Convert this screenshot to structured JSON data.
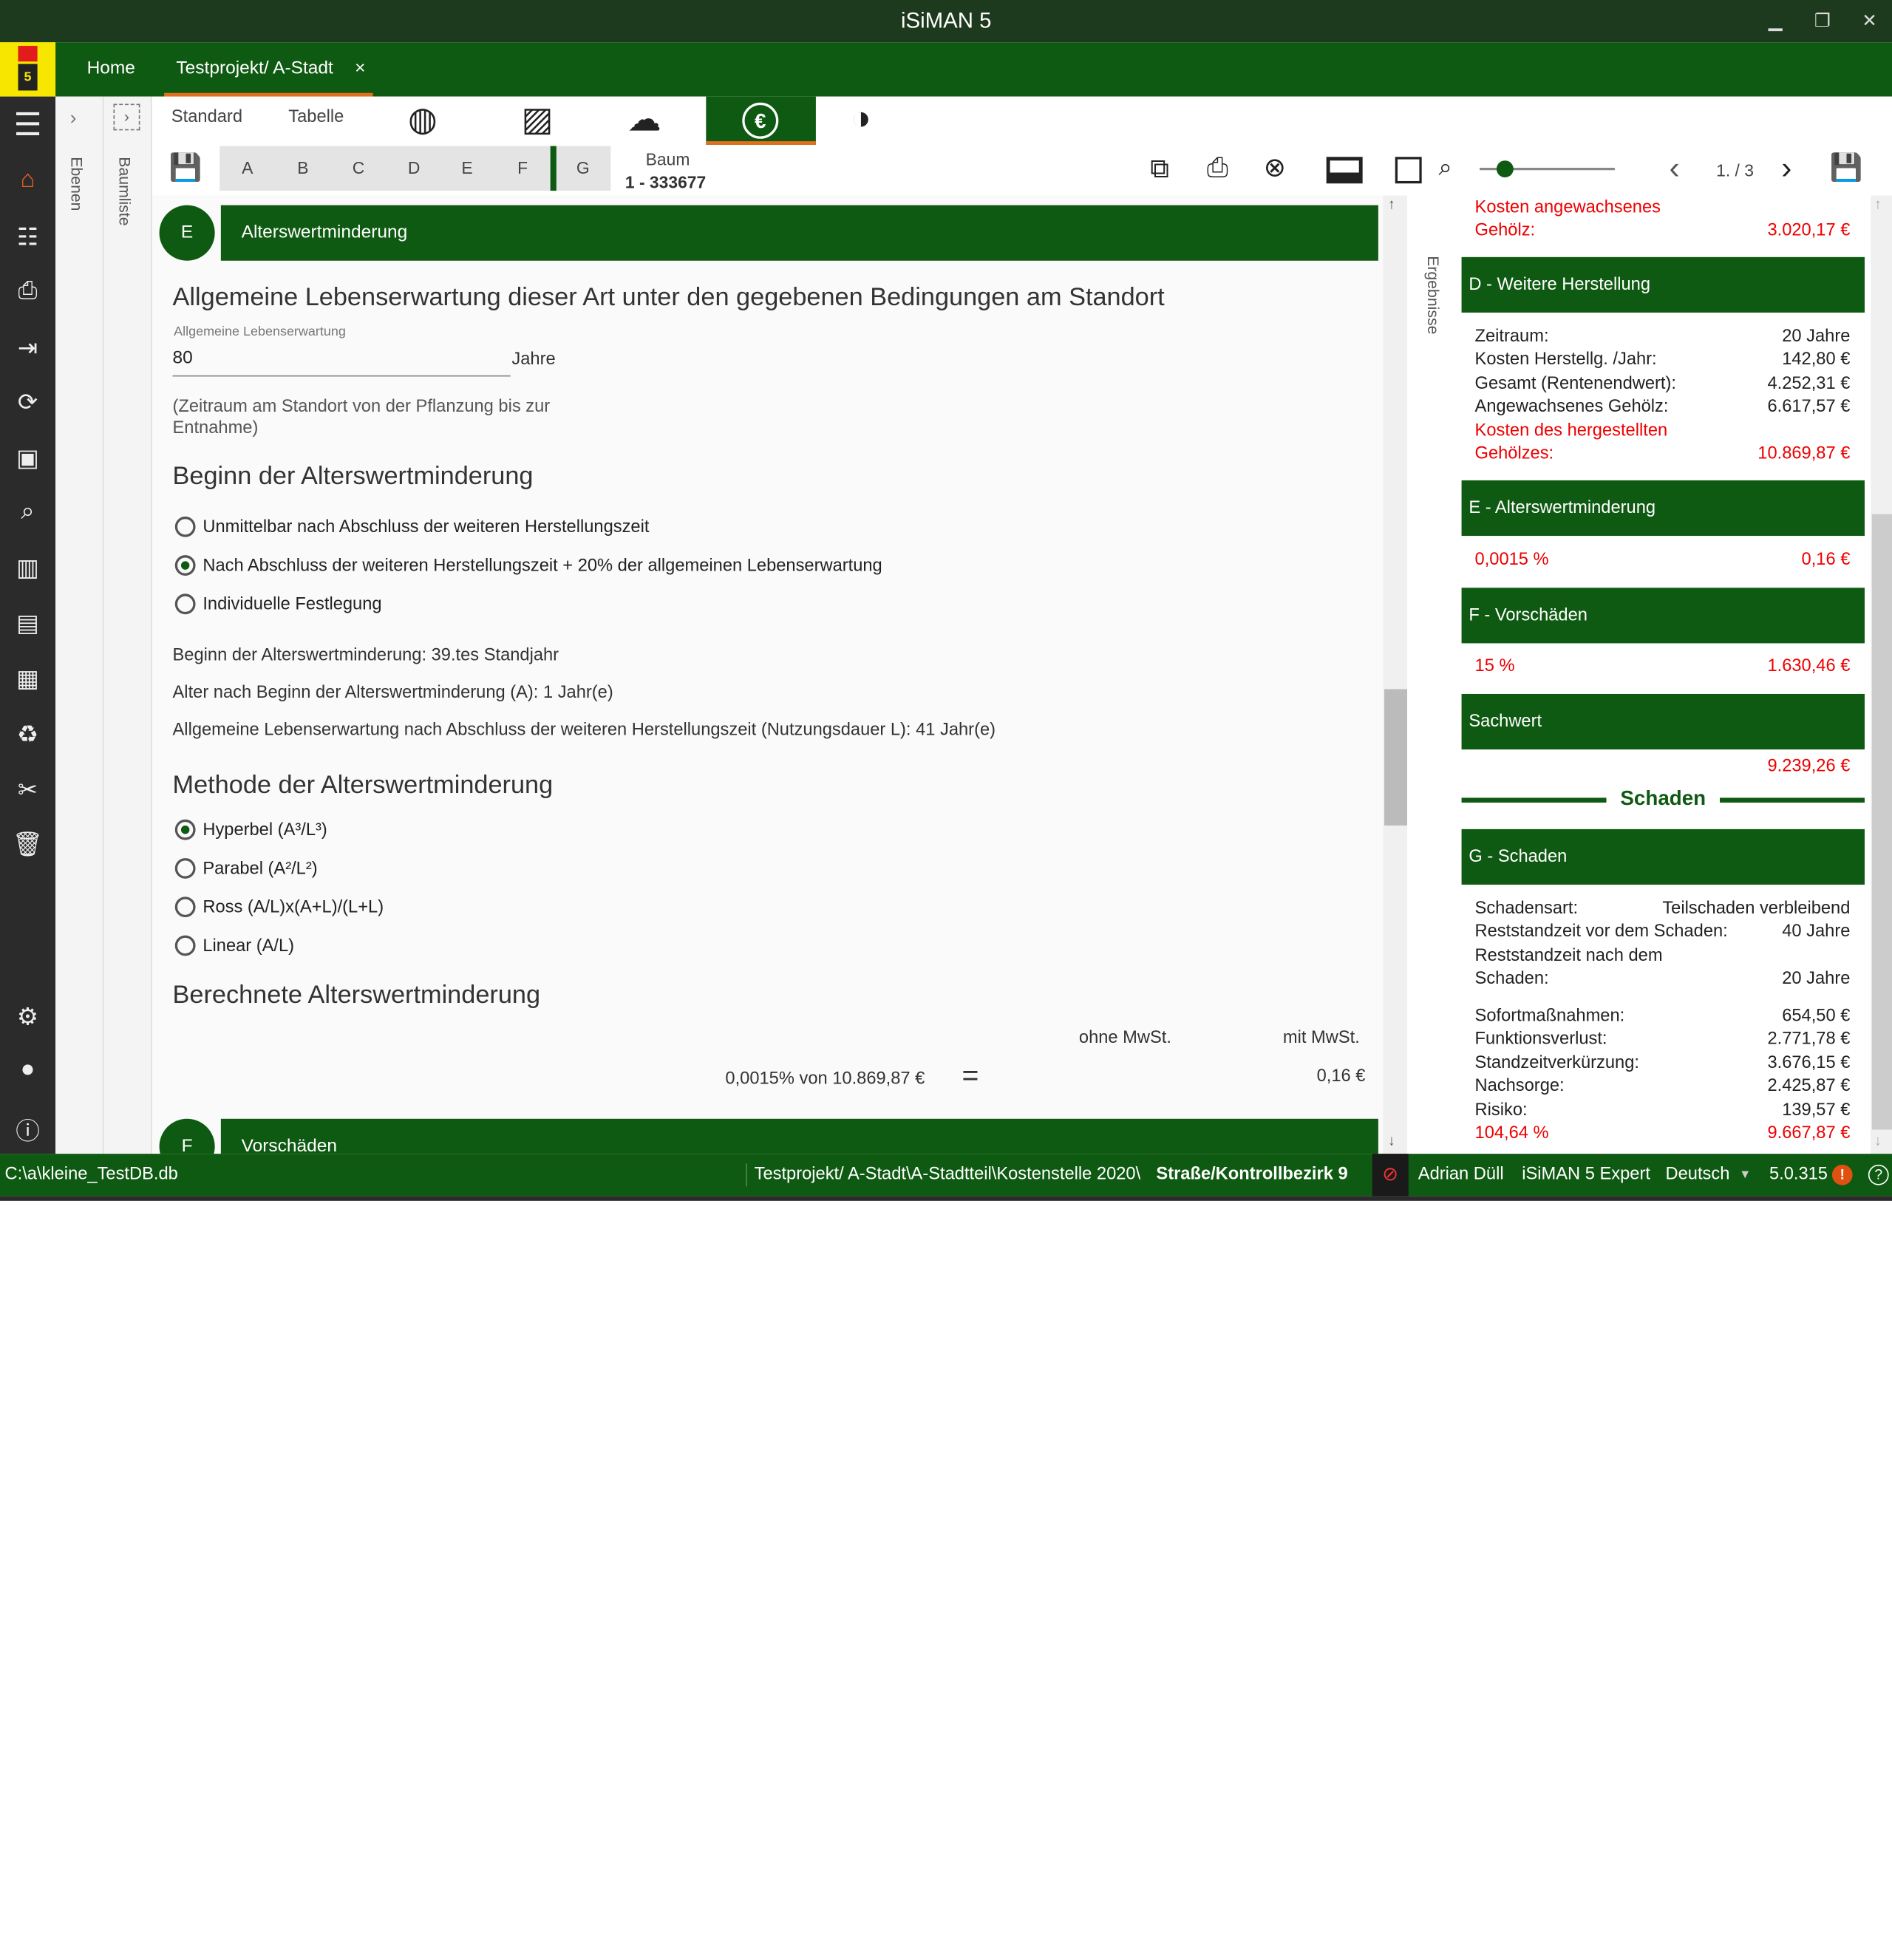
{
  "window": {
    "title": "iSiMAN 5",
    "minimize": "▁",
    "restore": "❐",
    "close": "✕"
  },
  "tabs": {
    "home": "Home",
    "project": "Testprojekt/ A-Stadt",
    "close": "×"
  },
  "sidebar_strips": {
    "ebenen": "Ebenen",
    "baumliste": "Baumliste",
    "ergebnisse": "Ergebnisse"
  },
  "toolbar": {
    "standard": "Standard",
    "tabelle": "Tabelle",
    "letters": [
      "A",
      "B",
      "C",
      "D",
      "E",
      "F",
      "G"
    ],
    "baum_label": "Baum",
    "baum_id": "1 - 333677",
    "page": "1. / 3"
  },
  "section_e": {
    "badge": "E",
    "title": "Alterswertminderung"
  },
  "lebenserwartung": {
    "heading": "Allgemeine Lebenserwartung dieser Art unter den gegebenen Bedingungen am Standort",
    "field_label": "Allgemeine Lebenserwartung",
    "value": "80",
    "unit": "Jahre",
    "note_line1": "(Zeitraum am Standort von der Pflanzung bis zur",
    "note_line2": "Entnahme)"
  },
  "beginn": {
    "heading": "Beginn der Alterswertminderung",
    "options": [
      "Unmittelbar nach Abschluss der weiteren Herstellungszeit",
      "Nach Abschluss der weiteren Herstellungszeit + 20% der allgemeinen Lebenserwartung",
      "Individuelle Festlegung"
    ],
    "selected_index": 1,
    "info1": "Beginn der Alterswertminderung: 39.tes Standjahr",
    "info2": "Alter nach Beginn der Alterswertminderung (A): 1 Jahr(e)",
    "info3": "Allgemeine Lebenserwartung nach Abschluss der weiteren Herstellungszeit (Nutzungsdauer L): 41 Jahr(e)"
  },
  "methode": {
    "heading": "Methode der Alterswertminderung",
    "options": [
      "Hyperbel (A³/L³)",
      "Parabel (A²/L²)",
      "Ross (A/L)x(A+L)/(L+L)",
      "Linear (A/L)"
    ],
    "selected_index": 0
  },
  "berechnet": {
    "heading": "Berechnete Alterswertminderung",
    "col_ohne": "ohne MwSt.",
    "col_mit": "mit MwSt.",
    "formula": "0,0015% von 10.869,87 €",
    "equals": "=",
    "result": "0,16 €"
  },
  "section_f": {
    "badge": "F",
    "title": "Vorschäden"
  },
  "results": {
    "kosten_angewachsen_l1": "Kosten angewachsenes",
    "kosten_angewachsen_l2": "Gehölz:",
    "kosten_angewachsen_v": "3.020,17 €",
    "d_title": "D - Weitere Herstellung",
    "d_rows": [
      {
        "l": "Zeitraum:",
        "v": "20 Jahre"
      },
      {
        "l": "Kosten Herstellg. /Jahr:",
        "v": "142,80 €"
      },
      {
        "l": "Gesamt (Rentenendwert):",
        "v": "4.252,31 €"
      },
      {
        "l": "Angewachsenes Gehölz:",
        "v": "6.617,57 €"
      }
    ],
    "d_total_l1": "Kosten des hergestellten",
    "d_total_l2": "Gehölzes:",
    "d_total_v": "10.869,87 €",
    "e_title": "E - Alterswertminderung",
    "e_pct": "0,0015 %",
    "e_v": "0,16 €",
    "f_title": "F - Vorschäden",
    "f_pct": "15 %",
    "f_v": "1.630,46 €",
    "sach_title": "Sachwert",
    "sach_v": "9.239,26 €",
    "schaden_divider": "Schaden",
    "g_title": "G - Schaden",
    "g_art_l": "Schadensart:",
    "g_art_v": "Teilschaden verbleibend",
    "g_rest_vor_l": "Reststandzeit vor dem Schaden:",
    "g_rest_vor_v": "40 Jahre",
    "g_rest_nach_l1": "Reststandzeit nach dem",
    "g_rest_nach_l2": "Schaden:",
    "g_rest_nach_v": "20 Jahre",
    "g_rows": [
      {
        "l": "Sofortmaßnahmen:",
        "v": "654,50 €"
      },
      {
        "l": "Funktionsverlust:",
        "v": "2.771,78 €"
      },
      {
        "l": "Standzeitverkürzung:",
        "v": "3.676,15 €"
      },
      {
        "l": "Nachsorge:",
        "v": "2.425,87 €"
      },
      {
        "l": "Risiko:",
        "v": "139,57 €"
      }
    ],
    "g_total_pct": "104,64 %",
    "g_total_v": "9.667,87 €"
  },
  "status": {
    "db": "C:\\a\\kleine_TestDB.db",
    "path": "Testprojekt/ A-Stadt\\A-Stadtteil\\Kostenstelle 2020\\",
    "path_bold": "Straße/Kontrollbezirk 9",
    "user": "Adrian Düll",
    "edition": "iSiMAN 5 Expert",
    "lang": "Deutsch",
    "version": "5.0.315",
    "warn": "!",
    "help": "?"
  }
}
